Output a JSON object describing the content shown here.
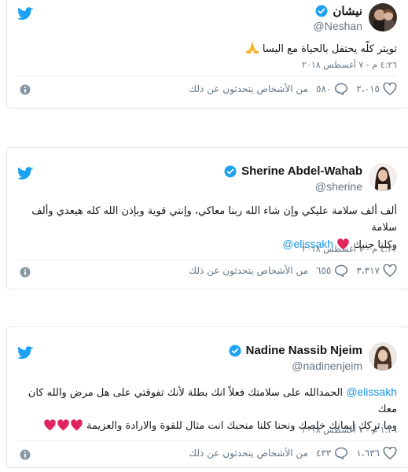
{
  "colors": {
    "twitter_blue": "#1da1f2",
    "mention_blue": "#1b95e0",
    "heart_red": "#e0245e",
    "muted": "#657786"
  },
  "tweets": [
    {
      "name": "نيشان",
      "handle": "@Neshan",
      "verified": true,
      "text": "تويتر كلّه يحتفل بالحياة مع اليسا",
      "emoji": "folded-hands",
      "time": "٤:٢٦ م - ٧ أغسطس ٢٠١٨",
      "likes": "٢،٠١٥",
      "replies": "٥٨٠",
      "talking": "من الأشخاص يتحدثون عن ذلك"
    },
    {
      "name": "Sherine Abdel-Wahab",
      "handle": "@sherine",
      "verified": true,
      "text_line1": "ألف ألف سلامة عليكي وإن شاء الله ربنا معاكي، وإنتي قوية وبإذن الله كله هيعدي وألف سلامة",
      "text_line2": "وكلنا جنبك",
      "mention": "@elissakh",
      "time": "٤:٢٢ م - ٧ أغسطس ٢٠١٨",
      "likes": "٣،٣١٧",
      "replies": "٦٥٥",
      "talking": "من الأشخاص يتحدثون عن ذلك"
    },
    {
      "name": "Nadine Nassib Njeim",
      "handle": "@nadinenjeim",
      "verified": true,
      "mention": "@elissakh",
      "text_line1": "الحمدالله على سلامتك فعلاً انك بطلة لأنك تفوقتي على هل مرض والله كان معك",
      "text_line2": "وما تركك إيمانك خلصك ونحنا كلنا منحبك انت مثال للقوة والارادة والعزيمة",
      "time": "١:٢٦ م - ٧ أغسطس ٢٠١٨",
      "likes": "١،٦٣٦",
      "replies": "٤٣٣",
      "talking": "من الأشخاص يتحدثون عن ذلك"
    }
  ]
}
